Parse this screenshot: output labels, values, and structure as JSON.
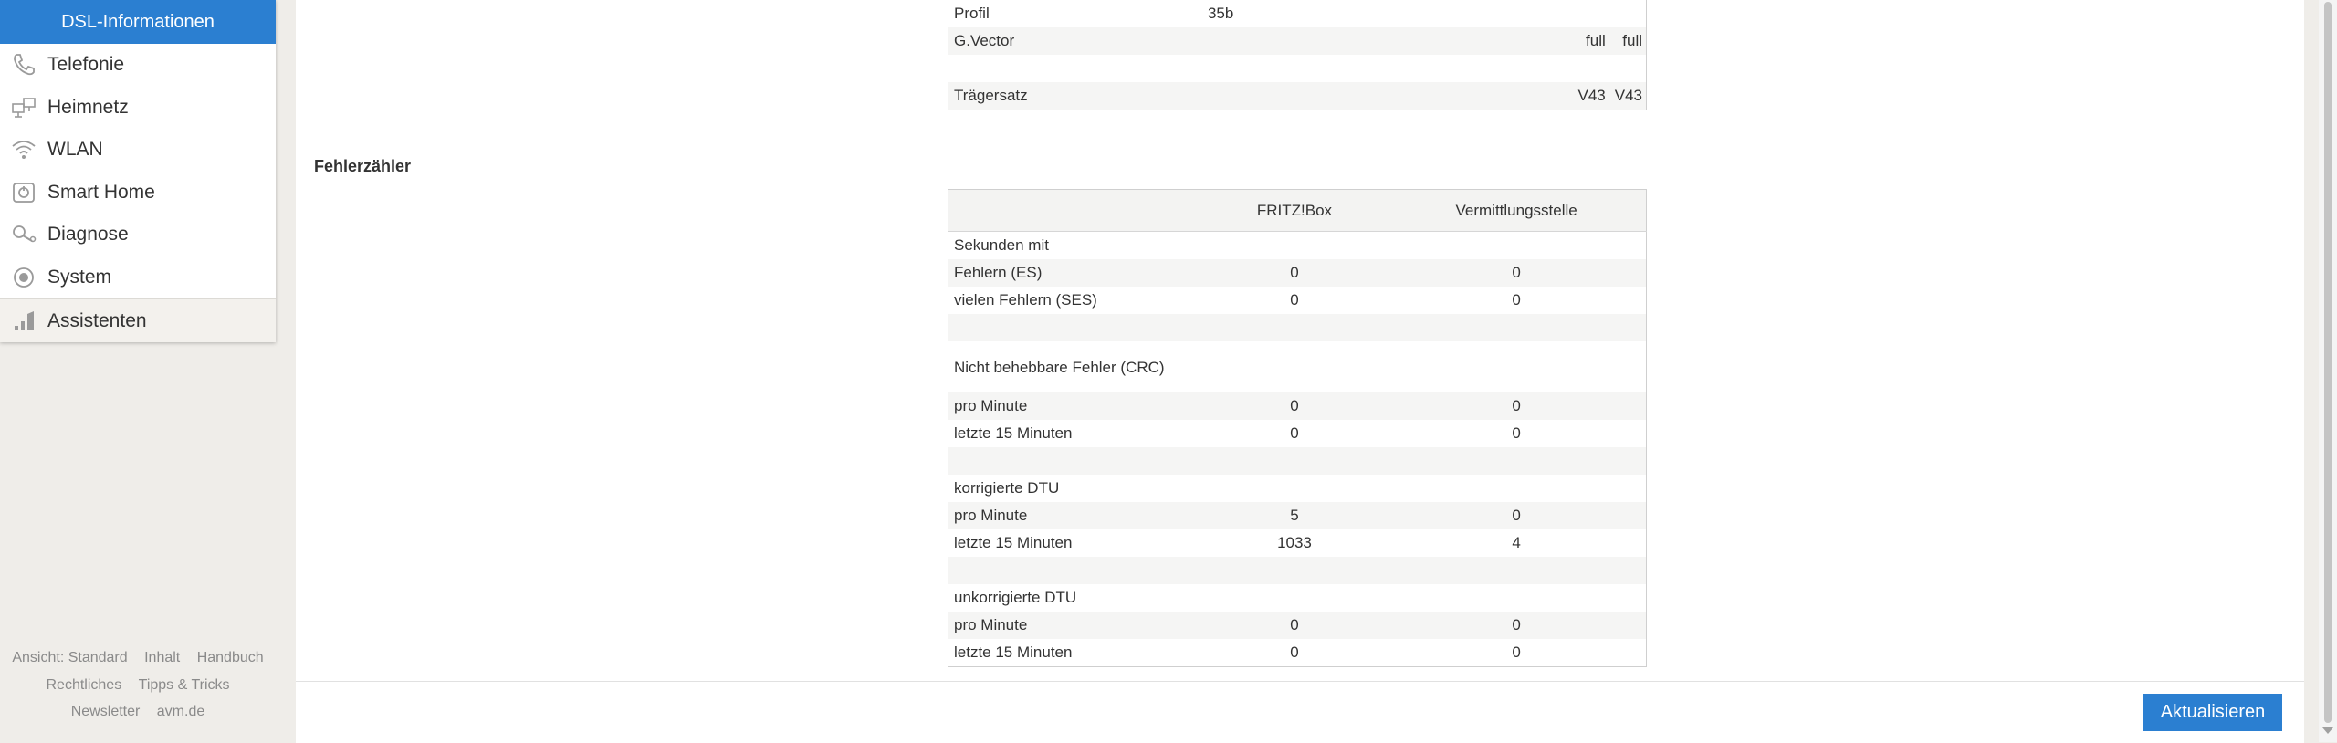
{
  "sidebar": {
    "active_sub": "DSL-Informationen",
    "items": [
      {
        "label": "Telefonie",
        "icon": "phone-icon"
      },
      {
        "label": "Heimnetz",
        "icon": "network-icon"
      },
      {
        "label": "WLAN",
        "icon": "wifi-icon"
      },
      {
        "label": "Smart Home",
        "icon": "smarthome-icon"
      },
      {
        "label": "Diagnose",
        "icon": "diagnose-icon"
      },
      {
        "label": "System",
        "icon": "system-icon"
      },
      {
        "label": "Assistenten",
        "icon": "wizard-icon"
      }
    ],
    "footer": {
      "ansicht": "Ansicht: Standard",
      "inhalt": "Inhalt",
      "handbuch": "Handbuch",
      "rechtliches": "Rechtliches",
      "tipps": "Tipps & Tricks",
      "newsletter": "Newsletter",
      "avm": "avm.de"
    }
  },
  "top_table": {
    "rows": [
      {
        "label": "Profil",
        "v1": "35b",
        "v2": "",
        "v3": ""
      },
      {
        "label": "G.Vector",
        "v1": "",
        "v2": "full",
        "v3": "full"
      },
      {
        "label": "",
        "v1": "",
        "v2": "",
        "v3": ""
      },
      {
        "label": "Trägersatz",
        "v1": "",
        "v2": "V43",
        "v3": "V43"
      }
    ]
  },
  "errors": {
    "title": "Fehlerzähler",
    "headers": [
      "",
      "FRITZ!Box",
      "Vermittlungsstelle"
    ],
    "rows": [
      {
        "label": "Sekunden mit",
        "box": "",
        "vst": ""
      },
      {
        "label": "Fehlern (ES)",
        "box": "0",
        "vst": "0"
      },
      {
        "label": "vielen Fehlern (SES)",
        "box": "0",
        "vst": "0"
      },
      {
        "label": "",
        "box": "",
        "vst": ""
      },
      {
        "label": "Nicht behebbare Fehler (CRC)",
        "box": "",
        "vst": ""
      },
      {
        "label": "pro Minute",
        "box": "0",
        "vst": "0"
      },
      {
        "label": "letzte 15 Minuten",
        "box": "0",
        "vst": "0"
      },
      {
        "label": "",
        "box": "",
        "vst": ""
      },
      {
        "label": "korrigierte DTU",
        "box": "",
        "vst": ""
      },
      {
        "label": "pro Minute",
        "box": "5",
        "vst": "0"
      },
      {
        "label": "letzte 15 Minuten",
        "box": "1033",
        "vst": "4"
      },
      {
        "label": "",
        "box": "",
        "vst": ""
      },
      {
        "label": "unkorrigierte DTU",
        "box": "",
        "vst": ""
      },
      {
        "label": "pro Minute",
        "box": "0",
        "vst": "0"
      },
      {
        "label": "letzte 15 Minuten",
        "box": "0",
        "vst": "0"
      }
    ]
  },
  "actions": {
    "refresh": "Aktualisieren"
  },
  "colors": {
    "accent": "#2b7fd1",
    "sidebar_bg": "#efede9"
  }
}
